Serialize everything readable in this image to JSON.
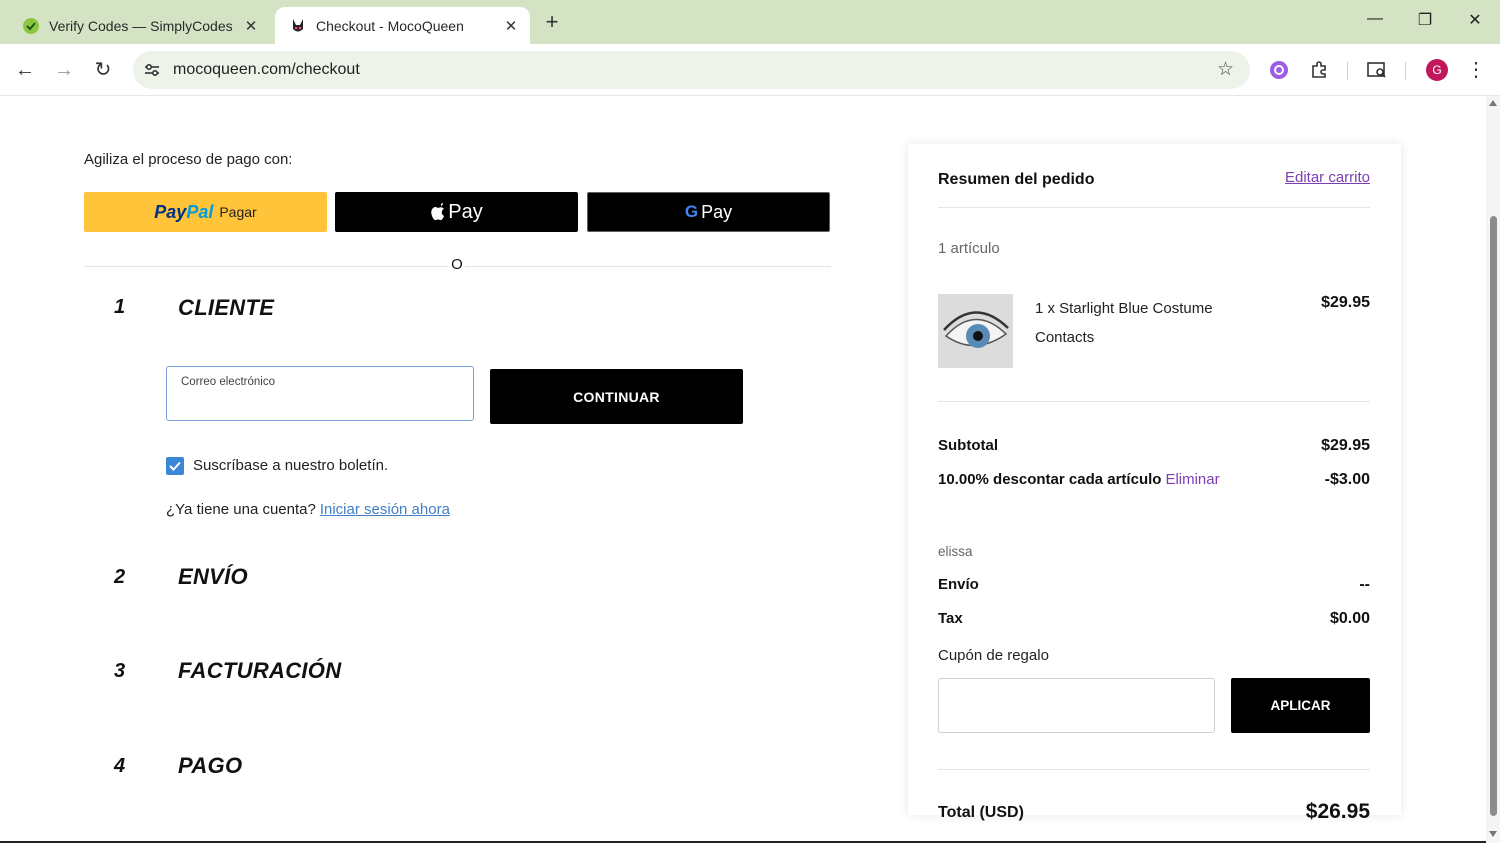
{
  "browser": {
    "tabs": [
      {
        "title": "Verify Codes — SimplyCodes",
        "favicon": "simplycodes-icon",
        "active": false
      },
      {
        "title": "Checkout - MocoQueen",
        "favicon": "mocoqueen-icon",
        "active": true
      }
    ],
    "new_tab_label": "+",
    "url": "mocoqueen.com/checkout",
    "window_controls": {
      "minimize": "—",
      "restore": "❐",
      "close": "✕"
    },
    "profile_initial": "G",
    "accent": "#d3e3c3"
  },
  "express": {
    "label": "Agiliza el proceso de pago con:",
    "paypal_pay": "Pay",
    "paypal_pal": "Pal",
    "paypal_word": "Pagar",
    "applepay_word": "Pay",
    "gpay_g": "G",
    "gpay_word": "Pay",
    "or_text": "O"
  },
  "steps": [
    {
      "num": "1",
      "title": "CLIENTE"
    },
    {
      "num": "2",
      "title": "ENVÍO"
    },
    {
      "num": "3",
      "title": "FACTURACIÓN"
    },
    {
      "num": "4",
      "title": "PAGO"
    }
  ],
  "customer": {
    "email_label": "Correo electrónico",
    "email_value": "",
    "continue_label": "CONTINUAR",
    "newsletter_label": "Suscríbase a nuestro boletín.",
    "newsletter_checked": true,
    "account_question": "¿Ya tiene una cuenta?",
    "login_link": "Iniciar sesión ahora"
  },
  "summary": {
    "title": "Resumen del pedido",
    "edit_cart": "Editar carrito",
    "items_count": "1 artículo",
    "item": {
      "name": "1 x Starlight Blue Costume Contacts",
      "price": "$29.95"
    },
    "subtotal_label": "Subtotal",
    "subtotal_value": "$29.95",
    "discount_label": "10.00% descontar cada artículo",
    "discount_remove": "Eliminar",
    "discount_value": "-$3.00",
    "discount_code": "elissa",
    "shipping_label": "Envío",
    "shipping_value": "--",
    "tax_label": "Tax",
    "tax_value": "$0.00",
    "gift_label": "Cupón de regalo",
    "gift_value": "",
    "apply_label": "APLICAR",
    "total_label": "Total (USD)",
    "total_value": "$26.95",
    "link_color": "#7b3fb3"
  }
}
